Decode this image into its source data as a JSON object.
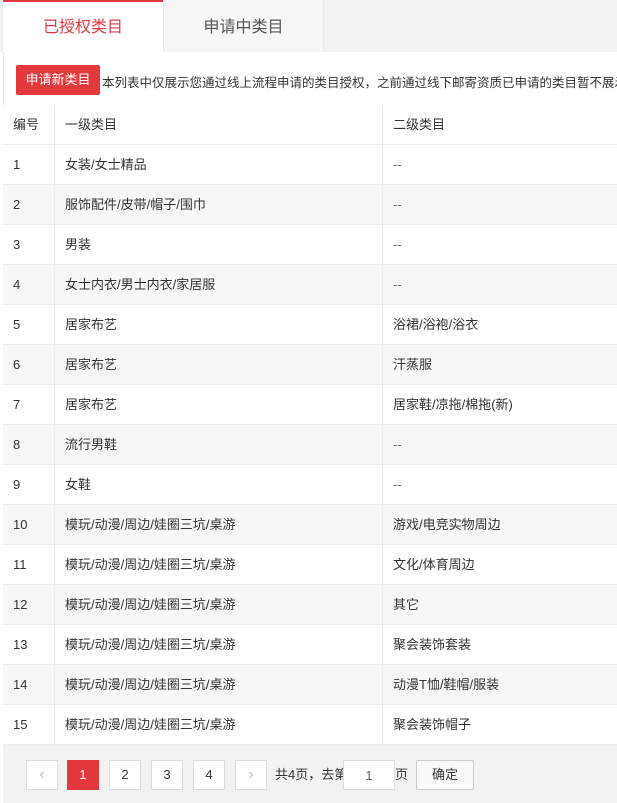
{
  "tabs": [
    {
      "label": "已授权类目"
    },
    {
      "label": "申请中类目"
    }
  ],
  "toolbar": {
    "apply_label": "申请新类目",
    "notice": "本列表中仅展示您通过线上流程申请的类目授权，之前通过线下邮寄资质已申请的类目暂不展示，"
  },
  "table": {
    "headers": {
      "no": "编号",
      "level1": "一级类目",
      "level2": "二级类目"
    },
    "rows": [
      {
        "no": "1",
        "level1": "女装/女士精品",
        "level2": "--"
      },
      {
        "no": "2",
        "level1": "服饰配件/皮带/帽子/围巾",
        "level2": "--"
      },
      {
        "no": "3",
        "level1": "男装",
        "level2": "--"
      },
      {
        "no": "4",
        "level1": "女士内衣/男士内衣/家居服",
        "level2": "--"
      },
      {
        "no": "5",
        "level1": "居家布艺",
        "level2": "浴裙/浴袍/浴衣"
      },
      {
        "no": "6",
        "level1": "居家布艺",
        "level2": "汗蒸服"
      },
      {
        "no": "7",
        "level1": "居家布艺",
        "level2": "居家鞋/凉拖/棉拖(新)"
      },
      {
        "no": "8",
        "level1": "流行男鞋",
        "level2": "--"
      },
      {
        "no": "9",
        "level1": "女鞋",
        "level2": "--"
      },
      {
        "no": "10",
        "level1": "模玩/动漫/周边/娃圈三坑/桌游",
        "level2": "游戏/电竞实物周边"
      },
      {
        "no": "11",
        "level1": "模玩/动漫/周边/娃圈三坑/桌游",
        "level2": "文化/体育周边"
      },
      {
        "no": "12",
        "level1": "模玩/动漫/周边/娃圈三坑/桌游",
        "level2": "其它"
      },
      {
        "no": "13",
        "level1": "模玩/动漫/周边/娃圈三坑/桌游",
        "level2": "聚会装饰套装"
      },
      {
        "no": "14",
        "level1": "模玩/动漫/周边/娃圈三坑/桌游",
        "level2": "动漫T恤/鞋帽/服装"
      },
      {
        "no": "15",
        "level1": "模玩/动漫/周边/娃圈三坑/桌游",
        "level2": "聚会装饰帽子"
      }
    ]
  },
  "pager": {
    "prev_icon": "chevron-left-icon",
    "next_icon": "chevron-right-icon",
    "prev_glyph": "‹",
    "next_glyph": "›",
    "pages": [
      "1",
      "2",
      "3",
      "4"
    ],
    "current_page": "1",
    "total_text": "共4页，去第",
    "goto_value": "1",
    "page_suffix": "页",
    "confirm_label": "确定"
  },
  "colors": {
    "accent": "#e4393c"
  }
}
